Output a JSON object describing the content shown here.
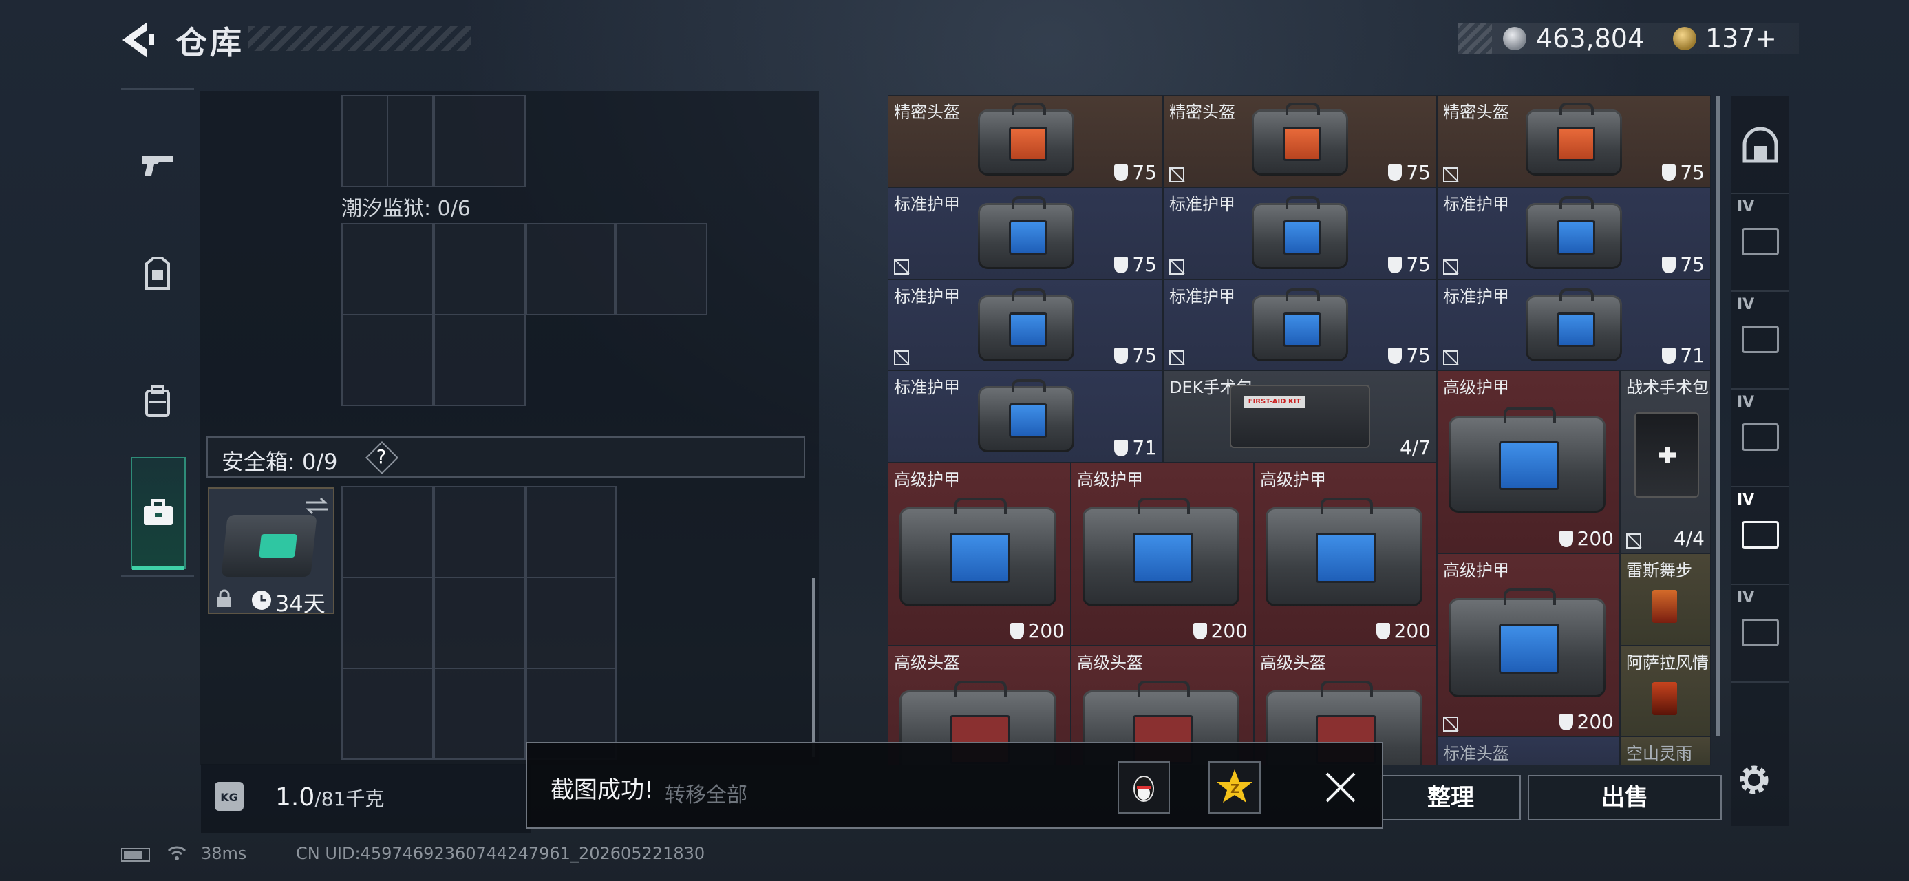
{
  "header": {
    "title": "仓库",
    "currency_silver": "463,804",
    "currency_gold": "137",
    "gold_plus": "+"
  },
  "left_panel": {
    "section_label": "潮汐监狱: 0/6",
    "safe_box_label": "安全箱: 0/9",
    "safe_box_help": "?",
    "case_timer": "34天",
    "weight_value": "1.0",
    "weight_limit": "/81千克"
  },
  "grid_items": [
    {
      "name": "精密头盔",
      "value": "75",
      "nodur": false
    },
    {
      "name": "精密头盔",
      "value": "75",
      "nodur": true
    },
    {
      "name": "精密头盔",
      "value": "75",
      "nodur": true
    },
    {
      "name": "标准护甲",
      "value": "75",
      "nodur": true
    },
    {
      "name": "标准护甲",
      "value": "75",
      "nodur": true
    },
    {
      "name": "标准护甲",
      "value": "75",
      "nodur": true
    },
    {
      "name": "标准护甲",
      "value": "75",
      "nodur": true
    },
    {
      "name": "标准护甲",
      "value": "75",
      "nodur": true
    },
    {
      "name": "标准护甲",
      "value": "71",
      "nodur": true
    },
    {
      "name": "标准护甲",
      "value": "71",
      "nodur": false
    },
    {
      "name": "DEK手术包",
      "value": "4/7",
      "nodur": false
    },
    {
      "name": "高级护甲",
      "value": "200",
      "nodur": false
    },
    {
      "name": "战术手术包",
      "value": "4/4",
      "nodur": true
    },
    {
      "name": "高级护甲",
      "value": "200",
      "nodur": false
    },
    {
      "name": "高级护甲",
      "value": "200",
      "nodur": false
    },
    {
      "name": "高级护甲",
      "value": "200",
      "nodur": false
    },
    {
      "name": "高级护甲",
      "value": "200",
      "nodur": true
    },
    {
      "name": "雷斯舞步",
      "value": "",
      "nodur": false
    },
    {
      "name": "阿萨拉风情",
      "value": "",
      "nodur": false
    },
    {
      "name": "高级头盔",
      "value": "",
      "nodur": false
    },
    {
      "name": "高级头盔",
      "value": "",
      "nodur": false
    },
    {
      "name": "高级头盔",
      "value": "",
      "nodur": false
    },
    {
      "name": "标准头盔",
      "value": "",
      "nodur": false
    },
    {
      "name": "空山灵雨",
      "value": "",
      "nodur": false
    }
  ],
  "kit_tag": "FIRST-AID KIT",
  "right_categories": [
    "IV",
    "IV",
    "IV",
    "IV",
    "IV"
  ],
  "buttons": {
    "tidy": "整理",
    "sell": "出售",
    "hidden_behind_toast": "转移全部"
  },
  "toast": {
    "message": "截图成功!"
  },
  "status": {
    "ping": "38ms",
    "uid": "CN UID:4597469236074424796​1_202605221830"
  },
  "colors": {
    "accent": "#3fd1a8",
    "brown_cell": "#4a3a32",
    "navy_cell": "#2f3752",
    "red_cell": "#5a2a2e"
  }
}
